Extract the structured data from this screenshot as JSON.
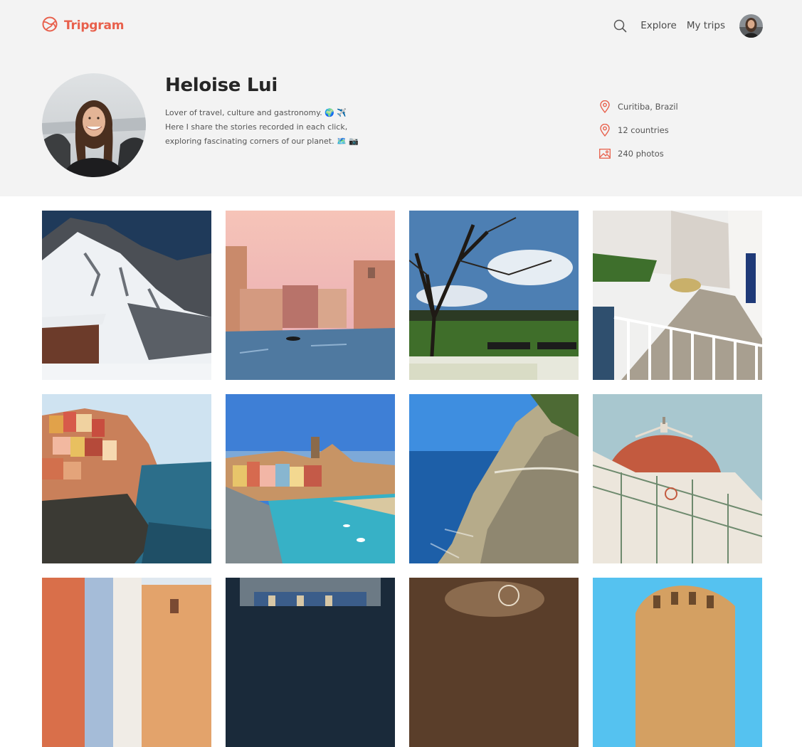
{
  "brand": {
    "name": "Tripgram",
    "color": "#e8604c"
  },
  "nav": {
    "search_icon": "search-icon",
    "links": [
      {
        "label": "Explore"
      },
      {
        "label": "My trips"
      }
    ]
  },
  "profile": {
    "name": "Heloise Lui",
    "bio_lines": [
      "Lover of travel, culture and gastronomy. 🌍 ✈️",
      "Here I share the stories recorded in each click,",
      "exploring fascinating corners of our planet. 🗺️ 📷"
    ],
    "stats": [
      {
        "icon": "location-pin-icon",
        "label": "Curitiba, Brazil"
      },
      {
        "icon": "location-pin-icon",
        "label": "12 countries"
      },
      {
        "icon": "image-icon",
        "label": "240 photos"
      }
    ]
  },
  "photos": [
    {
      "subject": "snowy-mountain"
    },
    {
      "subject": "venice-canal"
    },
    {
      "subject": "park-tree"
    },
    {
      "subject": "cobbled-street"
    },
    {
      "subject": "cliff-village"
    },
    {
      "subject": "harbor-town"
    },
    {
      "subject": "coastal-cliff"
    },
    {
      "subject": "florence-dome"
    },
    {
      "subject": "colorful-alley"
    },
    {
      "subject": "courtyard"
    },
    {
      "subject": "restaurant"
    },
    {
      "subject": "colosseum"
    }
  ]
}
